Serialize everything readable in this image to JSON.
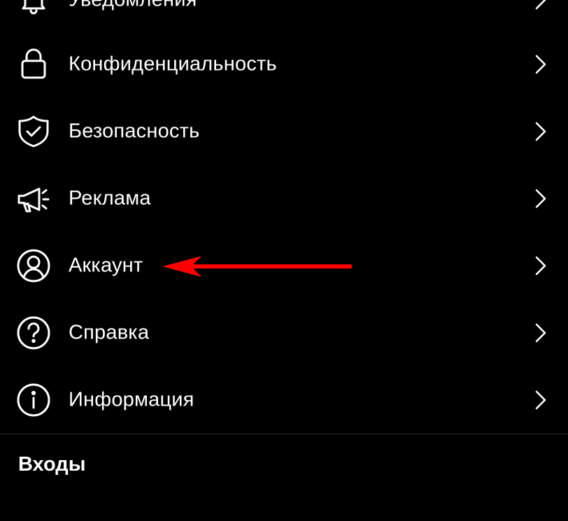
{
  "menu": {
    "items": [
      {
        "label": "Уведомления",
        "icon": "bell-icon"
      },
      {
        "label": "Конфиденциальность",
        "icon": "lock-icon"
      },
      {
        "label": "Безопасность",
        "icon": "shield-check-icon"
      },
      {
        "label": "Реклама",
        "icon": "megaphone-icon"
      },
      {
        "label": "Аккаунт",
        "icon": "user-circle-icon"
      },
      {
        "label": "Справка",
        "icon": "help-circle-icon"
      },
      {
        "label": "Информация",
        "icon": "info-circle-icon"
      }
    ]
  },
  "section": {
    "title": "Входы"
  },
  "annotation": {
    "arrow_color": "#ff0000",
    "target": "Аккаунт"
  },
  "colors": {
    "background": "#000000",
    "text": "#ffffff",
    "chevron": "#ffffff",
    "divider": "#2e2e2e"
  }
}
